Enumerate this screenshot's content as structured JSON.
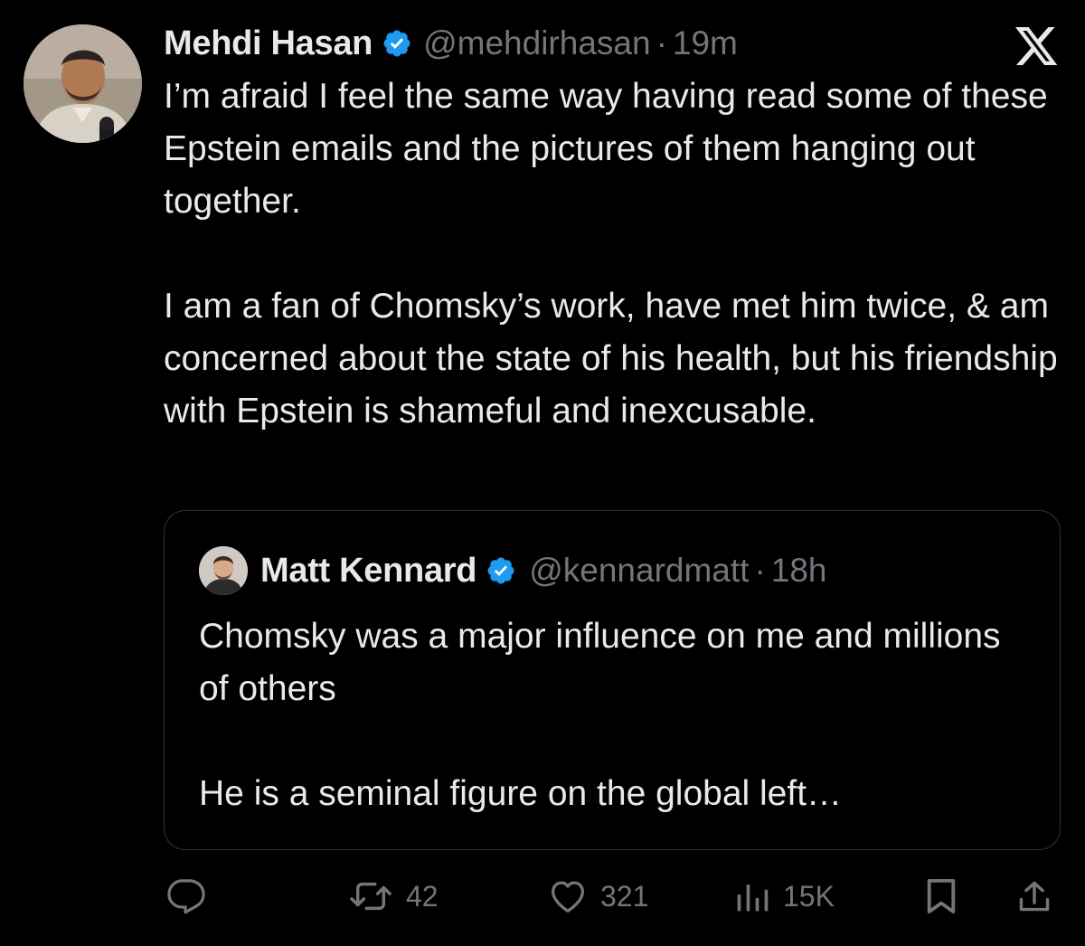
{
  "tweet": {
    "author": {
      "display_name": "Mehdi Hasan",
      "handle": "@mehdirhasan",
      "verified": true
    },
    "separator": "·",
    "time": "19m",
    "text": [
      "I’m afraid I feel the same way having read some of these Epstein emails and the pictures of them hanging out together.",
      "I am a fan of Chomsky’s work, have met him twice, & am concerned about the state of his health, but his friendship with Epstein is shameful and inexcusable."
    ],
    "quote": {
      "author": {
        "display_name": "Matt Kennard",
        "handle": "@kennardmatt",
        "verified": true
      },
      "separator": "·",
      "time": "18h",
      "text": [
        "Chomsky was a major influence on me and millions of others",
        "He is a seminal figure on the global left…"
      ]
    },
    "actions": {
      "reply": {
        "icon": "reply-icon",
        "count": ""
      },
      "retweet": {
        "icon": "retweet-icon",
        "count": "42"
      },
      "like": {
        "icon": "heart-icon",
        "count": "321"
      },
      "views": {
        "icon": "views-icon",
        "count": "15K"
      },
      "bookmark": {
        "icon": "bookmark-icon"
      },
      "share": {
        "icon": "share-icon"
      }
    }
  },
  "app_logo": "x-logo-icon",
  "colors": {
    "background": "#000000",
    "text_primary": "#e7e9ea",
    "text_secondary": "#71767b",
    "verified_blue": "#1d9bf0",
    "border": "#2f3336"
  }
}
